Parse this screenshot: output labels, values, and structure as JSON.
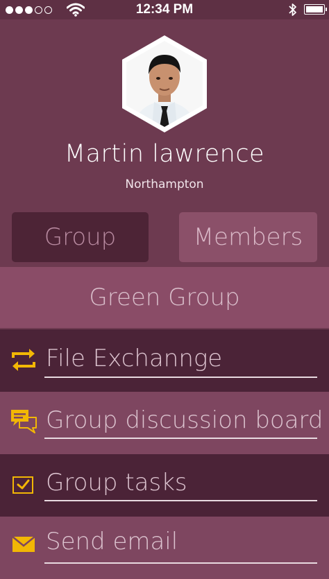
{
  "status_bar": {
    "time": "12:34 PM",
    "signal_bars_filled": 3,
    "signal_bars_total": 5
  },
  "profile": {
    "name": "Martin lawrence",
    "location": "Northampton"
  },
  "tabs": [
    {
      "label": "Group",
      "selected": true
    },
    {
      "label": "Members",
      "selected": false
    }
  ],
  "group": {
    "name": "Green Group"
  },
  "menu": [
    {
      "label": "File Exchannge",
      "icon": "swap-arrows-icon"
    },
    {
      "label": "Group discussion board",
      "icon": "chat-bubbles-icon"
    },
    {
      "label": "Group tasks",
      "icon": "checkbox-icon"
    },
    {
      "label": "Send email",
      "icon": "envelope-icon"
    }
  ],
  "colors": {
    "background": "#6d3a50",
    "accent_icon": "#f2b705",
    "tab_selected": "#4d2436",
    "tab_unselected": "#8b5069"
  }
}
